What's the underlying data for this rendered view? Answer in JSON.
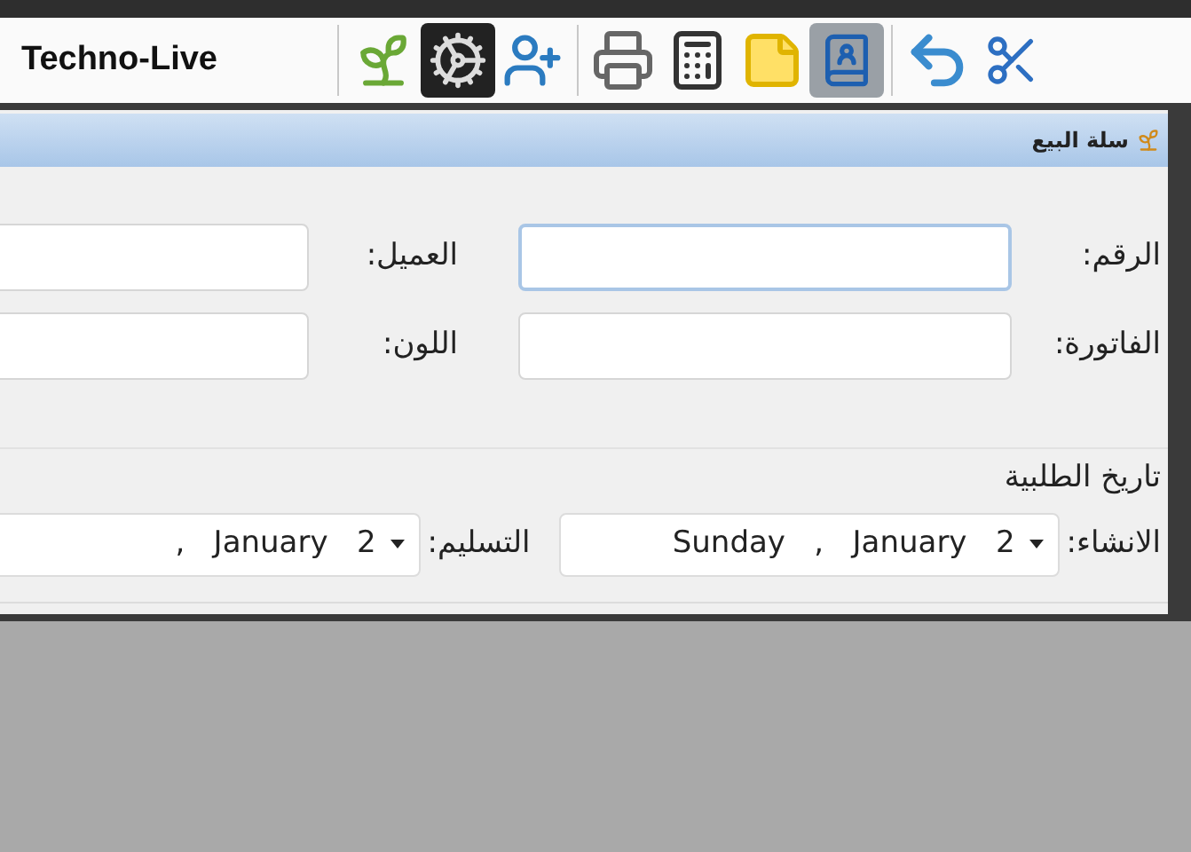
{
  "toolbar": {
    "title": "Techno-Live"
  },
  "window": {
    "title": "سلة البيع"
  },
  "fields": [
    {
      "label": "الرقم:",
      "focused": true
    },
    {
      "label": "العميل:",
      "focused": false
    },
    {
      "label": "الفاتورة:",
      "focused": false
    },
    {
      "label": "اللون:",
      "focused": false
    }
  ],
  "order_date": {
    "title": "تاريخ الطلبية",
    "pickers": [
      {
        "label": "الانشاء:",
        "value": "Sunday   ,   January   2"
      },
      {
        "label": "التسليم:",
        "value": ",   January   2"
      }
    ]
  }
}
